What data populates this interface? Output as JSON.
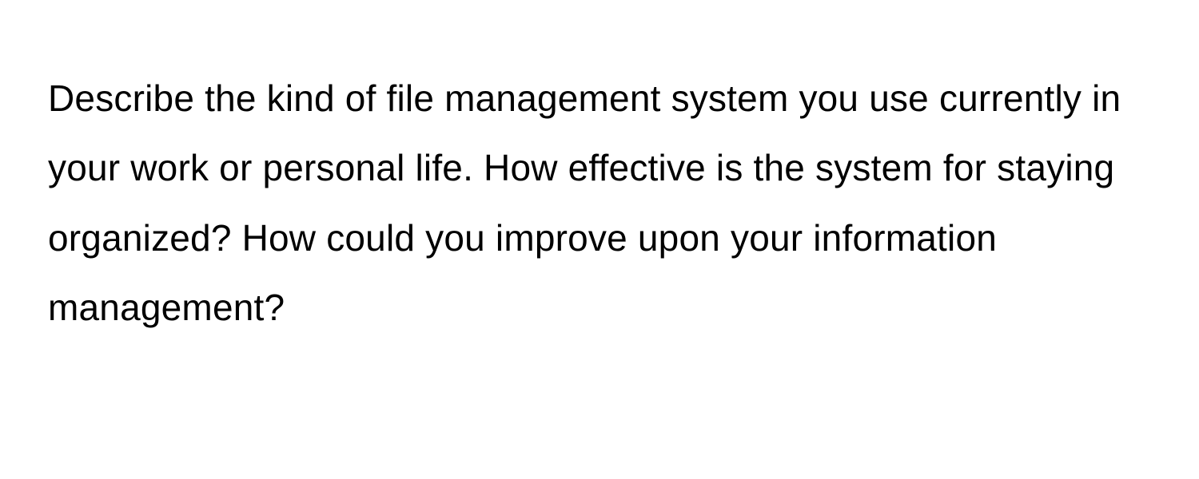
{
  "document": {
    "body": "Describe the kind of file management system you use currently in your work or personal life. How effective is the system for staying organized? How could you improve upon your information management?"
  }
}
